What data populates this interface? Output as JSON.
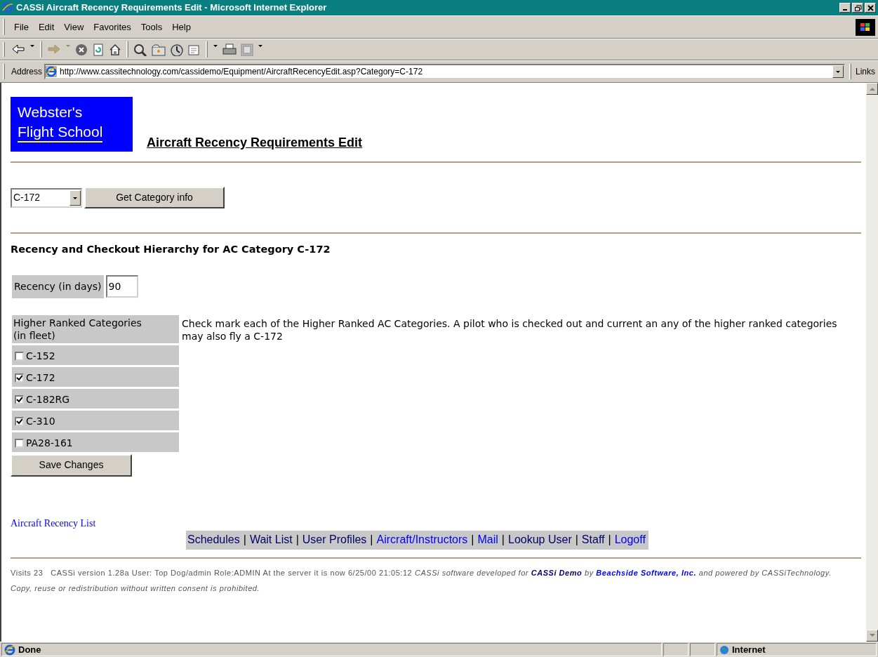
{
  "window": {
    "title": "CASSi Aircraft Recency Requirements Edit - Microsoft Internet Explorer"
  },
  "menu": [
    "File",
    "Edit",
    "View",
    "Favorites",
    "Tools",
    "Help"
  ],
  "address": {
    "label": "Address",
    "value": "http://www.cassitechnology.com/cassidemo/Equipment/AircraftRecencyEdit.asp?Category=C-172",
    "links_label": "Links"
  },
  "logo": {
    "lines": [
      "Webster's",
      "Flight School"
    ]
  },
  "page_title": "Aircraft Recency Requirements Edit",
  "category_select": {
    "value": "C-172"
  },
  "get_button": "Get Category info",
  "section_heading": "Recency and Checkout Hierarchy for AC Category C-172",
  "recency": {
    "label": "Recency (in days)",
    "value": "90"
  },
  "categories": {
    "header": "Higher Ranked Categories (in fleet)",
    "instructions": "Check mark each of the Higher Ranked AC Categories. A pilot who is checked out and current an any of the higher ranked categories may also fly a C-172",
    "items": [
      {
        "label": "C-152",
        "checked": false
      },
      {
        "label": "C-172",
        "checked": true
      },
      {
        "label": "C-182RG",
        "checked": true
      },
      {
        "label": "C-310",
        "checked": true
      },
      {
        "label": "PA28-161",
        "checked": false
      }
    ]
  },
  "save_button": "Save Changes",
  "list_link": "Aircraft Recency List",
  "nav_separator": "|",
  "nav_links": [
    {
      "label": "Schedules",
      "visited": true
    },
    {
      "label": "Wait List",
      "visited": true
    },
    {
      "label": "User Profiles",
      "visited": true
    },
    {
      "label": "Aircraft/Instructors",
      "visited": false
    },
    {
      "label": "Mail",
      "visited": false
    },
    {
      "label": "Lookup User",
      "visited": true
    },
    {
      "label": "Staff",
      "visited": true
    },
    {
      "label": "Logoff",
      "visited": false
    }
  ],
  "footer": {
    "segments": [
      {
        "kind": "text",
        "text": "Visits 23   CASSi version 1.28a User: Top Dog/admin Role:ADMIN At the server it is now 6/25/00 21:05:12 "
      },
      {
        "kind": "italic",
        "text": "CASSi software developed for "
      },
      {
        "kind": "link",
        "text": "CASSi Demo",
        "visited": true
      },
      {
        "kind": "italic",
        "text": " by "
      },
      {
        "kind": "link",
        "text": "Beachside Software, Inc.",
        "visited": false
      },
      {
        "kind": "italic",
        "text": " and powered by CASSiTechnology.  Copy, reuse or redistribution without written consent is prohibited."
      }
    ]
  },
  "status_bar": {
    "text": "Done",
    "zone": "Internet"
  }
}
